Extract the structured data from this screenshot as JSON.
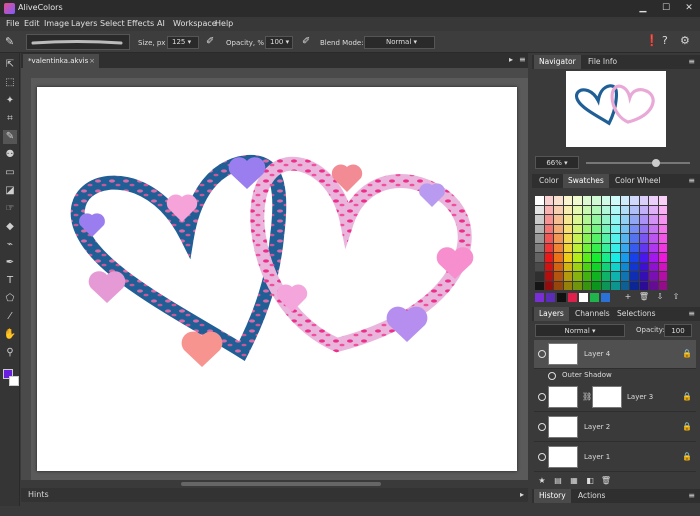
{
  "app": {
    "title": "AliveColors"
  },
  "menu": [
    "File",
    "Edit",
    "Image",
    "Layers",
    "Select",
    "Effects",
    "AI",
    "Workspace",
    "Help"
  ],
  "options": {
    "size_label": "Size, px",
    "size_value": "125",
    "opacity_label": "Opacity, %",
    "opacity_value": "100",
    "blend_label": "Blend Mode:",
    "blend_value": "Normal"
  },
  "document": {
    "tab_label": "*valentinka.akvis",
    "hints_label": "Hints"
  },
  "navigator": {
    "tabs": [
      "Navigator",
      "File Info"
    ],
    "zoom": "66%",
    "zoom_fraction": 0.66
  },
  "swatches": {
    "tabs": [
      "Color",
      "Swatches",
      "Color Wheel"
    ],
    "recent": [
      "#7a2fd6",
      "#5b2cb8",
      "#111111",
      "#e0204a",
      "#ffffff",
      "#1fb54a",
      "#2a72d8"
    ]
  },
  "layers_panel": {
    "tabs": [
      "Layers",
      "Channels",
      "Selections"
    ],
    "blend": "Normal",
    "opacity_label": "Opacity:",
    "opacity_value": "100",
    "layers": [
      {
        "name": "Layer 4",
        "effect": "Outer Shadow"
      },
      {
        "name": "Layer 3"
      },
      {
        "name": "Layer 2"
      },
      {
        "name": "Layer 1"
      }
    ]
  },
  "bottom_tabs": [
    "History",
    "Actions"
  ],
  "colors": {
    "foreground": "#6a1fe0",
    "background": "#ffffff",
    "heart_blue": "#1f5f96",
    "heart_pink": "#e9a9d7"
  }
}
